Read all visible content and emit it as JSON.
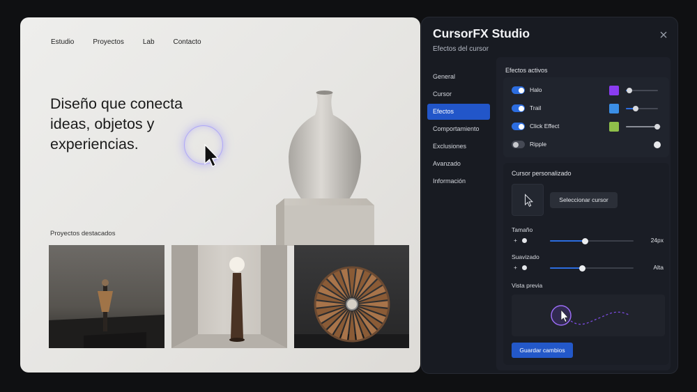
{
  "site": {
    "nav": [
      "Estudio",
      "Proyectos",
      "Lab",
      "Contacto"
    ],
    "hero_title": "Diseño que conecta ideas, objetos y experiencias.",
    "featured_label": "Proyectos destacados"
  },
  "panel": {
    "title": "CursorFX Studio",
    "subtitle": "Efectos del cursor",
    "close_icon": "close-icon",
    "nav": [
      {
        "label": "General",
        "active": false
      },
      {
        "label": "Cursor",
        "active": false
      },
      {
        "label": "Efectos",
        "active": true
      },
      {
        "label": "Comportamiento",
        "active": false
      },
      {
        "label": "Exclusiones",
        "active": false
      },
      {
        "label": "Avanzado",
        "active": false
      },
      {
        "label": "Información",
        "active": false
      }
    ],
    "effects_title": "Efectos activos",
    "effects": [
      {
        "label": "Halo",
        "enabled": true,
        "color": "#8a3cf0",
        "level": 0.1
      },
      {
        "label": "Trail",
        "enabled": true,
        "color": "#3b8fe6",
        "level": 0.3
      },
      {
        "label": "Click Effect",
        "enabled": true,
        "color": "#8fc04a",
        "level": 0.9
      },
      {
        "label": "Ripple",
        "enabled": false
      }
    ],
    "custom_title": "Cursor personalizado",
    "select_cursor_label": "Seleccionar cursor",
    "size_label": "Tamaño",
    "size_value": "24px",
    "size_level": 0.42,
    "smooth_label": "Suavizado",
    "smooth_value": "Alta",
    "smooth_level": 0.39,
    "plus_minus": "+",
    "preview_label": "Vista previa",
    "save_label": "Guardar cambios",
    "accent": "#2256c9"
  }
}
